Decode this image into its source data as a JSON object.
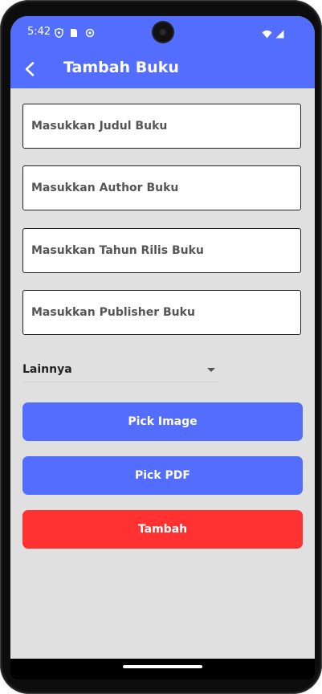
{
  "status_bar": {
    "time": "5:42",
    "background": "#536dfe",
    "left_icons": [
      "shield-icon",
      "sim-card-icon",
      "sync-icon"
    ],
    "right_icons": [
      "wifi-icon",
      "cellular-signal-icon"
    ]
  },
  "app_bar": {
    "title": "Tambah Buku",
    "back_icon": "arrow-back-icon",
    "background": "#536dfe"
  },
  "form": {
    "fields": [
      {
        "placeholder": "Masukkan Judul Buku"
      },
      {
        "placeholder": "Masukkan Author Buku"
      },
      {
        "placeholder": "Masukkan Tahun Rilis Buku"
      },
      {
        "placeholder": "Masukkan Publisher Buku"
      }
    ],
    "category_dropdown": {
      "selected": "Lainnya"
    }
  },
  "buttons": {
    "pick_image": "Pick Image",
    "pick_pdf": "Pick PDF",
    "submit": "Tambah"
  },
  "colors": {
    "primary": "#536dfe",
    "danger": "#ff3131",
    "screen_background": "#e0e0e0"
  }
}
